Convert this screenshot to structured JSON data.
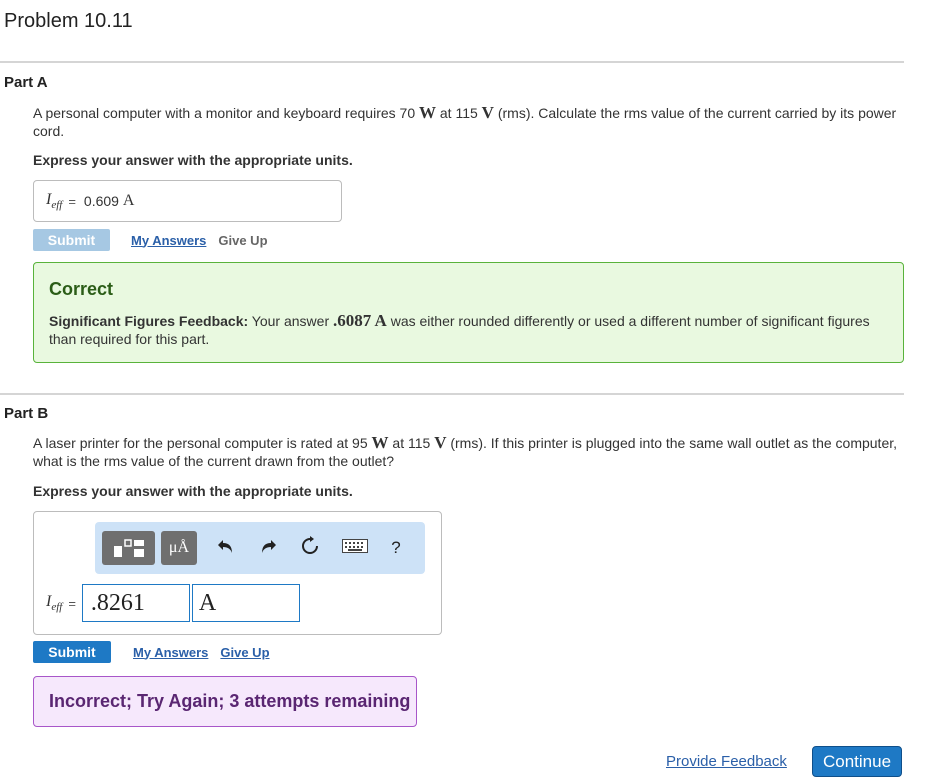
{
  "title": "Problem 10.11",
  "part_a": {
    "label": "Part A",
    "question_pre": "A personal computer with a monitor and keyboard requires 70 ",
    "question_unit1": "W",
    "question_mid": " at 115 ",
    "question_unit2": "V",
    "question_post": " (rms). Calculate the rms value of the current carried by its power cord.",
    "instruction": "Express your answer with the appropriate units.",
    "answer_var": "I",
    "answer_sub": "eff",
    "answer_eq": "=",
    "answer_value": "0.609",
    "answer_unit": "A",
    "submit_label": "Submit",
    "my_answers_label": "My Answers",
    "give_up_label": "Give Up",
    "feedback_title": "Correct",
    "sf_label": "Significant Figures Feedback:",
    "sf_pre": " Your answer ",
    "sf_value": ".6087 A",
    "sf_post": " was either rounded differently or used a different number of significant figures than required for this part."
  },
  "part_b": {
    "label": "Part B",
    "question_pre": "A laser printer for the personal computer is rated at 95 ",
    "question_unit1": "W",
    "question_mid": " at 115 ",
    "question_unit2": "V",
    "question_post": " (rms). If this printer is plugged into the same wall outlet as the computer, what is the rms value of the current drawn from the outlet?",
    "instruction": "Express your answer with the appropriate units.",
    "toolbar": {
      "units_button": "μÅ",
      "help": "?"
    },
    "answer_var": "I",
    "answer_sub": "eff",
    "answer_eq": "=",
    "input_value": ".8261",
    "input_unit": "A",
    "submit_label": "Submit",
    "my_answers_label": "My Answers",
    "give_up_label": "Give Up",
    "feedback": "Incorrect; Try Again; 3 attempts remaining"
  },
  "footer": {
    "feedback_link": "Provide Feedback",
    "continue_label": "Continue"
  },
  "colors": {
    "accent": "#1e79c5",
    "correct_bg": "#e9f9e0",
    "incorrect_bg": "#f6e8fc"
  }
}
